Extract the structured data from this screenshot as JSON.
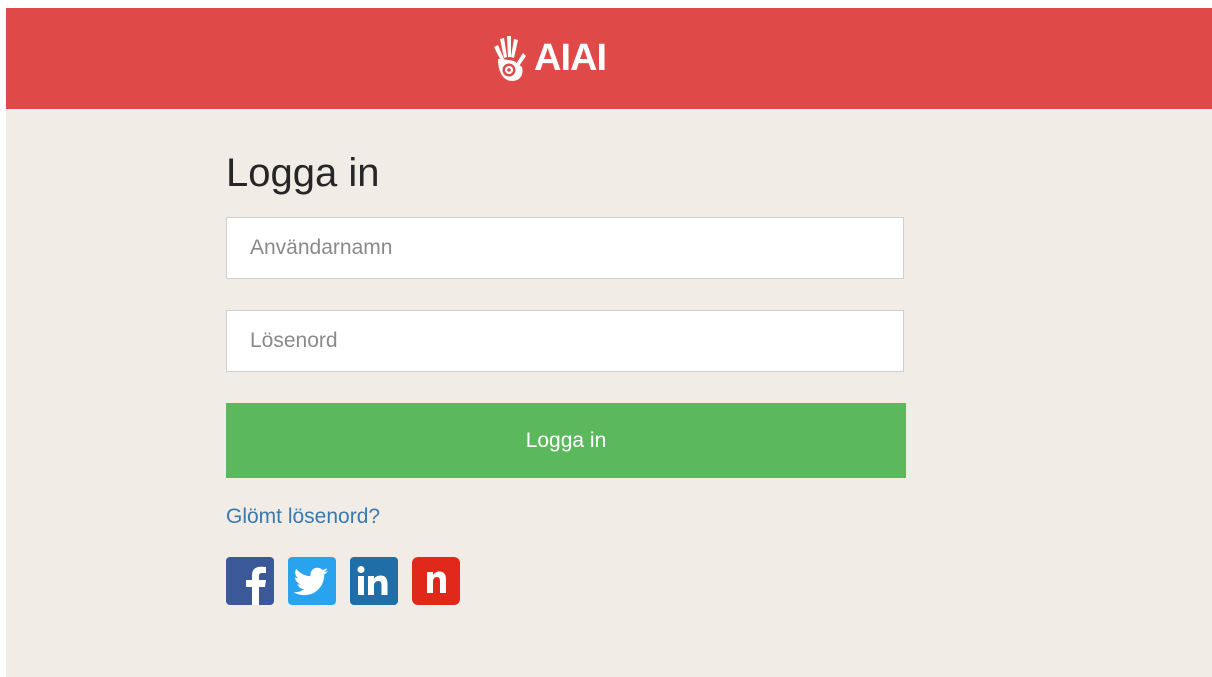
{
  "header": {
    "logo_text": "AIAI",
    "logo_icon": "hand-icon",
    "brand_color": "#df4a48"
  },
  "login": {
    "title": "Logga in",
    "username_placeholder": "Användarnamn",
    "username_value": "",
    "password_placeholder": "Lösenord",
    "password_value": "",
    "submit_label": "Logga in",
    "submit_color": "#5cb85c",
    "forgot_label": "Glömt lösenord?"
  },
  "social": [
    {
      "name": "facebook-icon",
      "color": "#3b5998"
    },
    {
      "name": "twitter-icon",
      "color": "#2aa3ef"
    },
    {
      "name": "linkedin-icon",
      "color": "#1f6ea7"
    },
    {
      "name": "n-icon",
      "color": "#e0291b"
    }
  ]
}
